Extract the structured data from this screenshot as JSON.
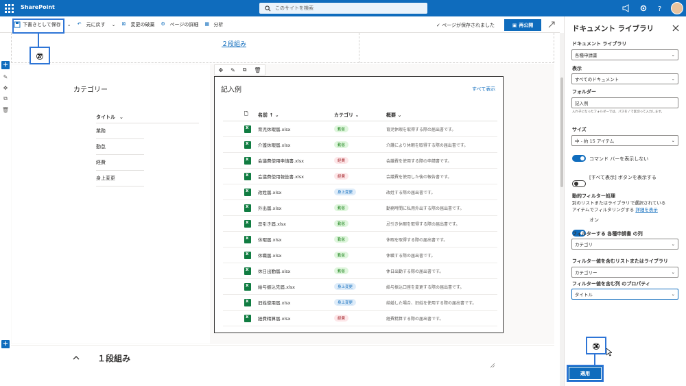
{
  "suite": {
    "app_name": "SharePoint",
    "search_placeholder": "このサイトを検索"
  },
  "commands": {
    "save_draft": "下書きとして保存",
    "undo": "元に戻す",
    "discard": "変更の破棄",
    "page_details": "ページの詳細",
    "analytics": "分析",
    "saved_status": "ページが保存されました",
    "publish": "再公開"
  },
  "section1": {
    "link": "２段組み"
  },
  "categories_part": {
    "title": "カテゴリー",
    "column": "タイトル",
    "items": [
      "業務",
      "勤怠",
      "経費",
      "身上変更"
    ]
  },
  "doclib": {
    "title": "記入例",
    "show_all": "すべて表示",
    "columns": {
      "name": "名前",
      "category": "カテゴリ",
      "summary": "概要"
    },
    "rows": [
      {
        "name": "育児休暇届.xlsx",
        "category": "勤怠",
        "cat_color": "#dff6dd",
        "cat_text": "#107c10",
        "summary": "育児休暇を取得する際の届出書です。"
      },
      {
        "name": "介護休暇届.xlsx",
        "category": "勤怠",
        "cat_color": "#dff6dd",
        "cat_text": "#107c10",
        "summary": "介護により休暇を取得する際の届出書です。"
      },
      {
        "name": "会議費使用申請書.xlsx",
        "category": "経費",
        "cat_color": "#fde7e9",
        "cat_text": "#a4262c",
        "summary": "会議費を使用する際の申請書です。"
      },
      {
        "name": "会議費使用報告書.xlsx",
        "category": "経費",
        "cat_color": "#fde7e9",
        "cat_text": "#a4262c",
        "summary": "会議費を使用した後の報告書です。"
      },
      {
        "name": "改姓届.xlsx",
        "category": "身上変更",
        "cat_color": "#deecf9",
        "cat_text": "#0f6cbd",
        "summary": "改姓する際の届出書です。"
      },
      {
        "name": "外出届.xlsx",
        "category": "勤怠",
        "cat_color": "#dff6dd",
        "cat_text": "#107c10",
        "summary": "勤務時間に私用外出する際の届出書です。"
      },
      {
        "name": "忌引き届.xlsx",
        "category": "勤怠",
        "cat_color": "#dff6dd",
        "cat_text": "#107c10",
        "summary": "忌引き休暇を取得する際の届出書です。"
      },
      {
        "name": "休暇届.xlsx",
        "category": "勤怠",
        "cat_color": "#dff6dd",
        "cat_text": "#107c10",
        "summary": "休暇を取得する際の届出書です。"
      },
      {
        "name": "休職届.xlsx",
        "category": "勤怠",
        "cat_color": "#dff6dd",
        "cat_text": "#107c10",
        "summary": "休職する際の届出書です。"
      },
      {
        "name": "休日出勤届.xlsx",
        "category": "勤怠",
        "cat_color": "#dff6dd",
        "cat_text": "#107c10",
        "summary": "休日出勤する際の届出書です。"
      },
      {
        "name": "給与振込先届.xlsx",
        "category": "身上変更",
        "cat_color": "#deecf9",
        "cat_text": "#0f6cbd",
        "summary": "給与振込口座を変更する際の届出書です。"
      },
      {
        "name": "旧姓使用届.xlsx",
        "category": "身上変更",
        "cat_color": "#deecf9",
        "cat_text": "#0f6cbd",
        "summary": "結婚した場合、旧姓を使用する際の届出書です。"
      },
      {
        "name": "経費精算届.xlsx",
        "category": "経費",
        "cat_color": "#fde7e9",
        "cat_text": "#a4262c",
        "summary": "経費精算する際の届出書です。"
      }
    ]
  },
  "section3": {
    "title": "１段組み"
  },
  "panel": {
    "title": "ドキュメント ライブラリ",
    "library_label": "ドキュメント ライブラリ",
    "library_value": "各種申請書",
    "view_label": "表示",
    "view_value": "すべてのドキュメント",
    "folder_label": "フォルダー",
    "folder_value": "記入例",
    "folder_hint": "入れ子になったフォルダーでは、パスを / で区切って入力します。",
    "size_label": "サイズ",
    "size_value": "中 - 約 15 アイテム",
    "toggle1_label": "コマンド バーを表示しない",
    "toggle2_label": "[すべて表示] ボタンを表示する",
    "dyn_label": "動的フィルター処理",
    "dyn_text1": "別のリストまたはライブラリで選択されている",
    "dyn_text2": "アイテムでフィルタリングする",
    "dyn_link": "詳細を表示",
    "dyn_state": "オン",
    "filter_col_label": "フィルターする 各種申請書 の列",
    "filter_col_value": "カテゴリ",
    "filter_src_label": "フィルター値を含むリストまたはライブラリ",
    "filter_src_value": "カテゴリー",
    "filter_prop_label": "フィルター値を含む列 のプロパティ",
    "filter_prop_value": "タイトル",
    "apply": "適用"
  },
  "callouts": {
    "save": "㉗",
    "apply": "㉖"
  },
  "colors": {
    "brand": "#0f6cbd",
    "callout": "#2e75d6"
  }
}
